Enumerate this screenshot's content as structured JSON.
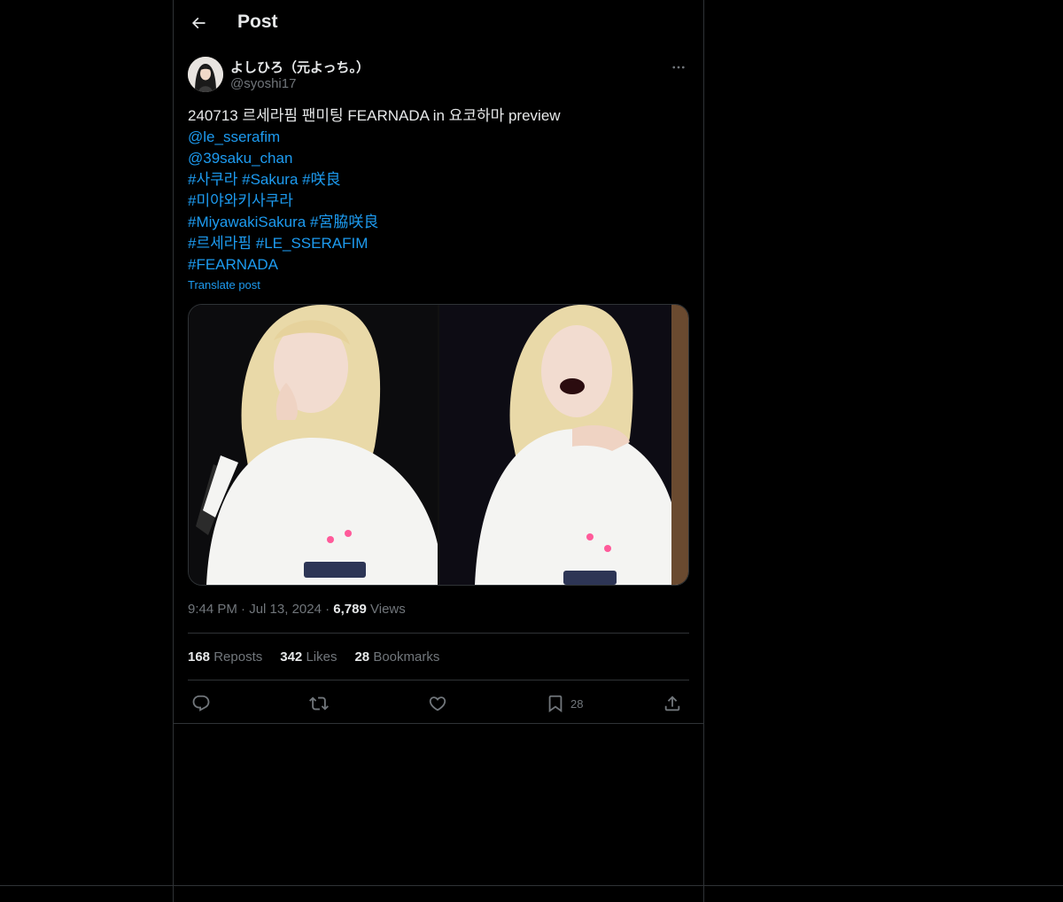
{
  "header": {
    "title": "Post",
    "back_icon": "arrow-left-icon"
  },
  "author": {
    "display_name": "よしひろ（元よっち。）",
    "handle": "@syoshi17",
    "more_icon": "ellipsis-icon"
  },
  "tweet": {
    "text_prefix": "240713 르세라핌 팬미팅 FEARNADA in 요코하마 preview",
    "mention_1": "@le_sserafim",
    "mention_2": "@39saku_chan",
    "hashtag_1": "#사쿠라",
    "hashtag_2": "#Sakura",
    "hashtag_3": "#咲良",
    "hashtag_4": "#미야와키사쿠라",
    "hashtag_5": "#MiyawakiSakura",
    "hashtag_6": "#宮脇咲良",
    "hashtag_7": "#르세라핌",
    "hashtag_8": "#LE_SSERAFIM",
    "hashtag_9": "#FEARNADA",
    "translate_label": "Translate post"
  },
  "meta": {
    "time": "9:44 PM",
    "separator": "·",
    "date": "Jul 13, 2024",
    "views_count": "6,789",
    "views_label": "Views"
  },
  "stats": {
    "reposts_count": "168",
    "reposts_label": "Reposts",
    "likes_count": "342",
    "likes_label": "Likes",
    "bookmarks_count": "28",
    "bookmarks_label": "Bookmarks"
  },
  "actions": {
    "reply_icon": "reply-icon",
    "repost_icon": "repost-icon",
    "like_icon": "heart-icon",
    "bookmark_icon": "bookmark-icon",
    "bookmark_count": "28",
    "share_icon": "share-icon"
  },
  "colors": {
    "background": "#000000",
    "text_primary": "#e7e9ea",
    "text_secondary": "#71767b",
    "accent": "#1d9bf0",
    "border": "#2f3336"
  }
}
